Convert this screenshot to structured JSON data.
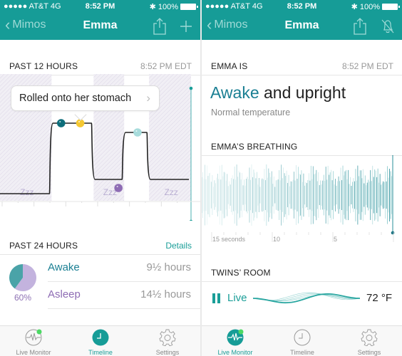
{
  "status_bar": {
    "carrier": "●●●●● AT&T  4G",
    "time": "8:52 PM",
    "battery": "100%",
    "bluetooth_icon": "bluetooth-icon"
  },
  "left_screen": {
    "nav": {
      "back_label": "Mimos",
      "title": "Emma",
      "share_icon": "share-icon",
      "add_icon": "plus-icon"
    },
    "past12": {
      "label": "PAST 12 HOURS",
      "time": "8:52 PM EDT",
      "tooltip": "Rolled onto her stomach",
      "sleep_marker": "Zzz",
      "chart_data": {
        "type": "line",
        "title": "Past 12 hours activity",
        "levels": [
          "asleep",
          "awake"
        ],
        "segments": [
          {
            "state": "asleep",
            "from": 0.0,
            "to": 0.27
          },
          {
            "state": "awake-high",
            "from": 0.27,
            "to": 0.49
          },
          {
            "state": "asleep",
            "from": 0.49,
            "to": 0.65
          },
          {
            "state": "awake-mid",
            "from": 0.65,
            "to": 0.78
          },
          {
            "state": "asleep",
            "from": 0.78,
            "to": 1.0
          }
        ],
        "events": [
          {
            "x": 0.32,
            "color": "#0e6e7b",
            "label": "event"
          },
          {
            "x": 0.42,
            "color": "#f5c832",
            "label": "Rolled onto her stomach"
          },
          {
            "x": 0.62,
            "color": "#8e6cb4",
            "label": "event"
          },
          {
            "x": 0.72,
            "color": "#a8dcdc",
            "label": "event"
          }
        ]
      }
    },
    "past24": {
      "label": "PAST 24 HOURS",
      "details_link": "Details",
      "pie_percent": "60%",
      "chart_data": {
        "type": "pie",
        "slices": [
          {
            "name": "Awake",
            "value": 40,
            "color": "#4aa3a8"
          },
          {
            "name": "Asleep",
            "value": 60,
            "color": "#c3b3de"
          }
        ]
      },
      "rows": [
        {
          "label": "Awake",
          "value": "9½ hours",
          "color": "#1a7f93"
        },
        {
          "label": "Asleep",
          "value": "14½ hours",
          "color": "#8e6cb4"
        }
      ]
    },
    "tabs": [
      {
        "label": "Live Monitor",
        "active": false
      },
      {
        "label": "Timeline",
        "active": true
      },
      {
        "label": "Settings",
        "active": false
      }
    ]
  },
  "right_screen": {
    "nav": {
      "back_label": "Mimos",
      "title": "Emma",
      "share_icon": "share-icon",
      "mute_icon": "bell-off-icon"
    },
    "emma_is": {
      "label": "EMMA IS",
      "time": "8:52 PM EDT",
      "state_highlight": "Awake",
      "state_rest": " and upright",
      "sub": "Normal temperature"
    },
    "breathing": {
      "label": "EMMA’S BREATHING",
      "axis_labels": [
        "15 seconds",
        "10",
        "5"
      ]
    },
    "room": {
      "label": "TWINS’ ROOM",
      "live_label": "Live",
      "temperature": "72 °F"
    },
    "tabs": [
      {
        "label": "Live Monitor",
        "active": true
      },
      {
        "label": "Timeline",
        "active": false
      },
      {
        "label": "Settings",
        "active": false
      }
    ]
  }
}
